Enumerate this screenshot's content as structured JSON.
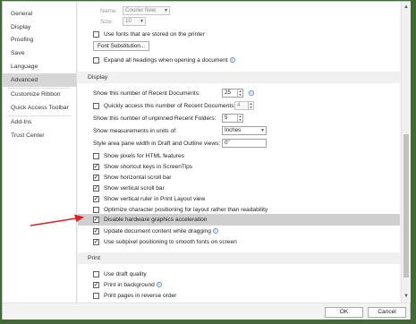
{
  "sidebar": {
    "items": [
      "General",
      "Display",
      "Proofing",
      "Save",
      "Language",
      "Advanced",
      "Customize Ribbon",
      "Quick Access Toolbar",
      "Add-Ins",
      "Trust Center"
    ],
    "active": "Advanced"
  },
  "font": {
    "name_label": "Name:",
    "name_value": "Courier New",
    "size_label": "Size:",
    "size_value": "10",
    "printer_fonts": "Use fonts that are stored on the printer",
    "substitution_button": "Font Substitution...",
    "expand_headings": "Expand all headings when opening a document"
  },
  "display": {
    "header": "Display",
    "recent_docs_label": "Show this number of Recent Documents:",
    "recent_docs_value": "25",
    "quick_access_label": "Quickly access this number of Recent Documents:",
    "quick_access_value": "4",
    "unpinned_folders_label": "Show this number of unpinned Recent Folders:",
    "unpinned_folders_value": "5",
    "units_label": "Show measurements in units of:",
    "units_value": "Inches",
    "style_pane_label": "Style area pane width in Draft and Outline views:",
    "style_pane_value": "0\"",
    "pixels_html": "Show pixels for HTML features",
    "shortcut_keys": "Show shortcut keys in ScreenTips",
    "horizontal_scroll": "Show horizontal scroll bar",
    "vertical_scroll": "Show vertical scroll bar",
    "vertical_ruler": "Show vertical ruler in Print Layout view",
    "optimize_char": "Optimize character positioning for layout rather than readability",
    "disable_hw": "Disable hardware graphics acceleration",
    "update_drag": "Update document content while dragging",
    "subpixel": "Use subpixel positioning to smooth fonts on screen"
  },
  "print": {
    "header": "Print",
    "draft_quality": "Use draft quality",
    "print_background": "Print in background",
    "reverse_order": "Print pages in reverse order"
  },
  "footer": {
    "ok": "OK",
    "cancel": "Cancel"
  },
  "checks": {
    "printer_fonts": false,
    "expand_headings": false,
    "quick_access": false,
    "pixels_html": false,
    "shortcut_keys": true,
    "horizontal_scroll": true,
    "vertical_scroll": true,
    "vertical_ruler": true,
    "optimize_char": false,
    "disable_hw": true,
    "update_drag": true,
    "subpixel": true,
    "draft_quality": false,
    "print_background": true,
    "reverse_order": false
  },
  "colors": {
    "highlight_row": "#cfcfcf",
    "active_nav": "#d6d6d6",
    "annotation_arrow": "#e02020",
    "info_icon": "#5b8ec7"
  }
}
